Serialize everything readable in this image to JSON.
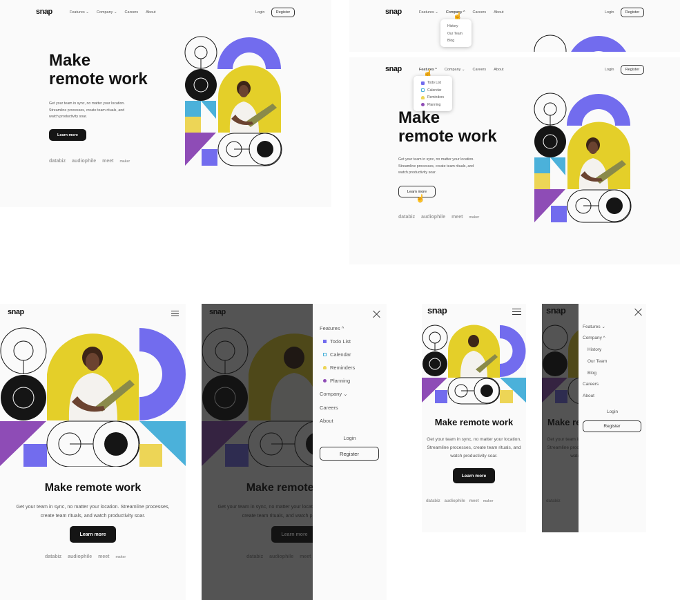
{
  "brand": "snap",
  "nav": {
    "features": "Features",
    "company": "Company",
    "careers": "Careers",
    "about": "About",
    "login": "Login",
    "register": "Register"
  },
  "chevrons": {
    "down": "⌄",
    "up": "^"
  },
  "hero": {
    "title_line1": "Make",
    "title_line2": "remote work",
    "title_single": "Make remote work",
    "desc_line1": "Get your team in sync, no matter your location.",
    "desc_line2": "Streamline processes, create team rituals, and",
    "desc_line3": "watch productivity soar.",
    "desc_full": "Get your team in sync, no matter your location. Streamline processes, create team rituals, and watch productivity soar.",
    "cta": "Learn more"
  },
  "clients": [
    "databiz",
    "audiophile",
    "meet",
    "maker"
  ],
  "company_menu": [
    "History",
    "Our Team",
    "Blog"
  ],
  "features_menu": [
    {
      "label": "Todo List",
      "icon": "todo-icon",
      "color": "#726cee"
    },
    {
      "label": "Calendar",
      "icon": "calendar-icon",
      "color": "#4bb1da"
    },
    {
      "label": "Reminders",
      "icon": "reminders-icon",
      "color": "#edd556"
    },
    {
      "label": "Planning",
      "icon": "planning-icon",
      "color": "#8e4cb6"
    }
  ],
  "colors": {
    "purple": "#8e4cb6",
    "indigo": "#726cee",
    "sky": "#4bb1da",
    "yellow": "#edd556",
    "yellow_bg": "#e4cf29",
    "dark": "#151515",
    "bg": "#fafafa"
  },
  "mobile": {
    "menu_icon": "hamburger-icon",
    "close_icon": "close-icon"
  }
}
